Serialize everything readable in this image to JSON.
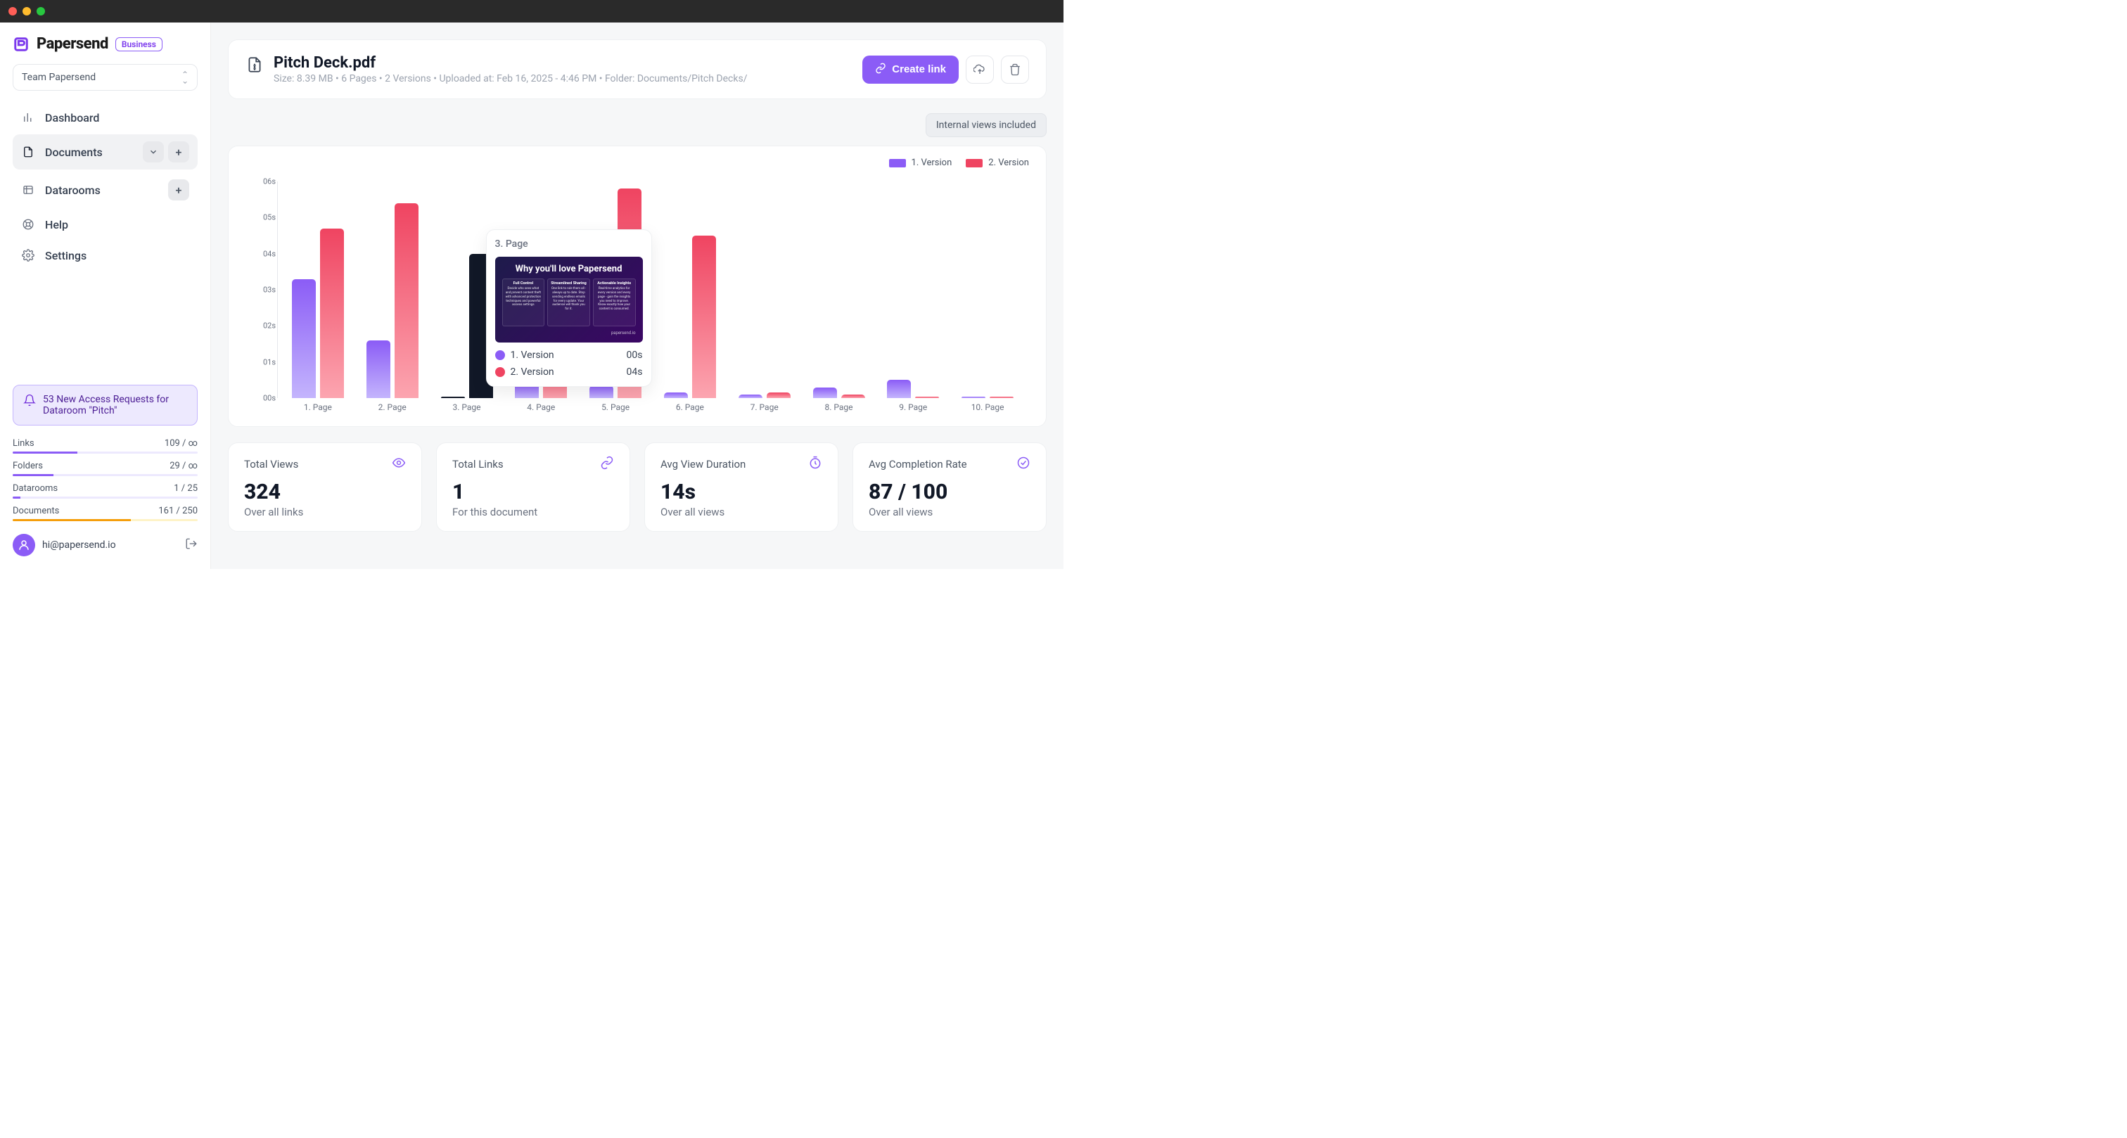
{
  "brand": {
    "name": "Papersend",
    "badge": "Business"
  },
  "team": {
    "label": "Team Papersend"
  },
  "nav": {
    "dashboard": "Dashboard",
    "documents": "Documents",
    "datarooms": "Datarooms",
    "help": "Help",
    "settings": "Settings"
  },
  "notice": {
    "text": "53 New Access Requests for Dataroom \"Pitch\""
  },
  "usage": {
    "links": {
      "label": "Links",
      "value": "109 / ∞",
      "pct": 35,
      "warn": false
    },
    "folders": {
      "label": "Folders",
      "value": "29 / ∞",
      "pct": 22,
      "warn": false
    },
    "datarooms": {
      "label": "Datarooms",
      "value": "1 / 25",
      "pct": 4,
      "warn": false
    },
    "documents": {
      "label": "Documents",
      "value": "161 / 250",
      "pct": 64,
      "warn": true
    }
  },
  "user": {
    "email": "hi@papersend.io"
  },
  "doc": {
    "title": "Pitch Deck.pdf",
    "meta": "Size: 8.39 MB • 6 Pages • 2 Versions • Uploaded at: Feb 16, 2025 - 4:46 PM • Folder: Documents/Pitch Decks/"
  },
  "actions": {
    "create_link": "Create link"
  },
  "filter": {
    "internal": "Internal views included"
  },
  "legend": {
    "v1": "1. Version",
    "v2": "2. Version"
  },
  "tooltip": {
    "page": "3. Page",
    "slide_title": "Why you'll love Papersend",
    "col1_h": "Full Control",
    "col1_t": "Decide who sees what and prevent content theft with advanced protection techniques and powerful access settings",
    "col2_h": "Streamlined Sharing",
    "col2_t": "One link to rule them all - always up to date. Stop sending endless emails for every update. Your audience will thank you for it.",
    "col3_h": "Actionable Insights",
    "col3_t": "Real-time analytics for every version and every page - gain the insights you need to improve. Know exactly how your content is consumed.",
    "brand_foot": "papersend.io",
    "v1_label": "1. Version",
    "v1_val": "00s",
    "v2_label": "2. Version",
    "v2_val": "04s"
  },
  "stats": {
    "views": {
      "label": "Total Views",
      "value": "324",
      "sub": "Over all links"
    },
    "links": {
      "label": "Total Links",
      "value": "1",
      "sub": "For this document"
    },
    "duration": {
      "label": "Avg View Duration",
      "value": "14s",
      "sub": "Over all views"
    },
    "completion": {
      "label": "Avg Completion Rate",
      "value": "87 / 100",
      "sub": "Over all views"
    }
  },
  "chart_data": {
    "type": "bar",
    "title": "",
    "ylabel": "",
    "xlabel": "",
    "y_ticks": [
      "00s",
      "01s",
      "02s",
      "03s",
      "04s",
      "05s",
      "06s"
    ],
    "ylim": [
      0,
      6
    ],
    "categories": [
      "1. Page",
      "2. Page",
      "3. Page",
      "4. Page",
      "5. Page",
      "6. Page",
      "7. Page",
      "8. Page",
      "9. Page",
      "10. Page"
    ],
    "series": [
      {
        "name": "1. Version",
        "color": "#8b5cf6",
        "values": [
          3.3,
          1.6,
          0.0,
          0.4,
          0.35,
          0.15,
          0.1,
          0.3,
          0.5,
          0.0
        ]
      },
      {
        "name": "2. Version",
        "color": "#ef4461",
        "values": [
          4.7,
          5.4,
          4.0,
          0.9,
          5.8,
          4.5,
          0.15,
          0.1,
          0.0,
          0.0
        ]
      }
    ],
    "hover_index": 2
  }
}
